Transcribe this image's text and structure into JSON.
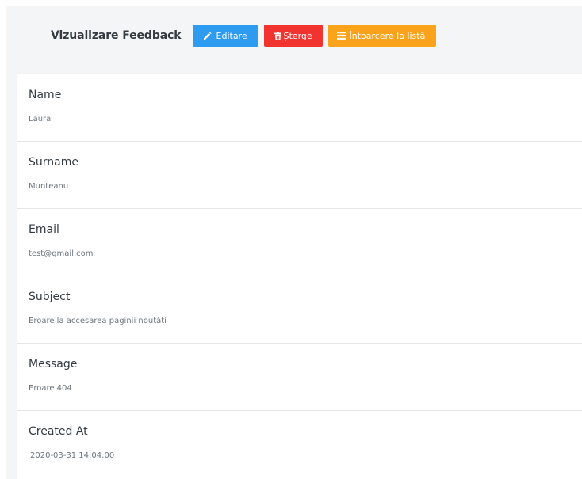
{
  "header": {
    "title": "Vizualizare Feedback",
    "edit_label": "Editare",
    "delete_label": "Șterge",
    "back_label": "Întoarcere la listă"
  },
  "colors": {
    "edit": "#2d9bf0",
    "delete": "#f1342f",
    "back": "#fba31b"
  },
  "icons": {
    "edit": "pencil-icon",
    "delete": "trash-icon",
    "back": "list-icon"
  },
  "fields": [
    {
      "label": "Name",
      "value": "Laura"
    },
    {
      "label": "Surname",
      "value": "Munteanu"
    },
    {
      "label": "Email",
      "value": "test@gmail.com"
    },
    {
      "label": "Subject",
      "value": "Eroare la accesarea paginii noutăți"
    },
    {
      "label": "Message",
      "value": "Eroare 404"
    },
    {
      "label": "Created At",
      "value": "2020-03-31 14:04:00"
    }
  ]
}
